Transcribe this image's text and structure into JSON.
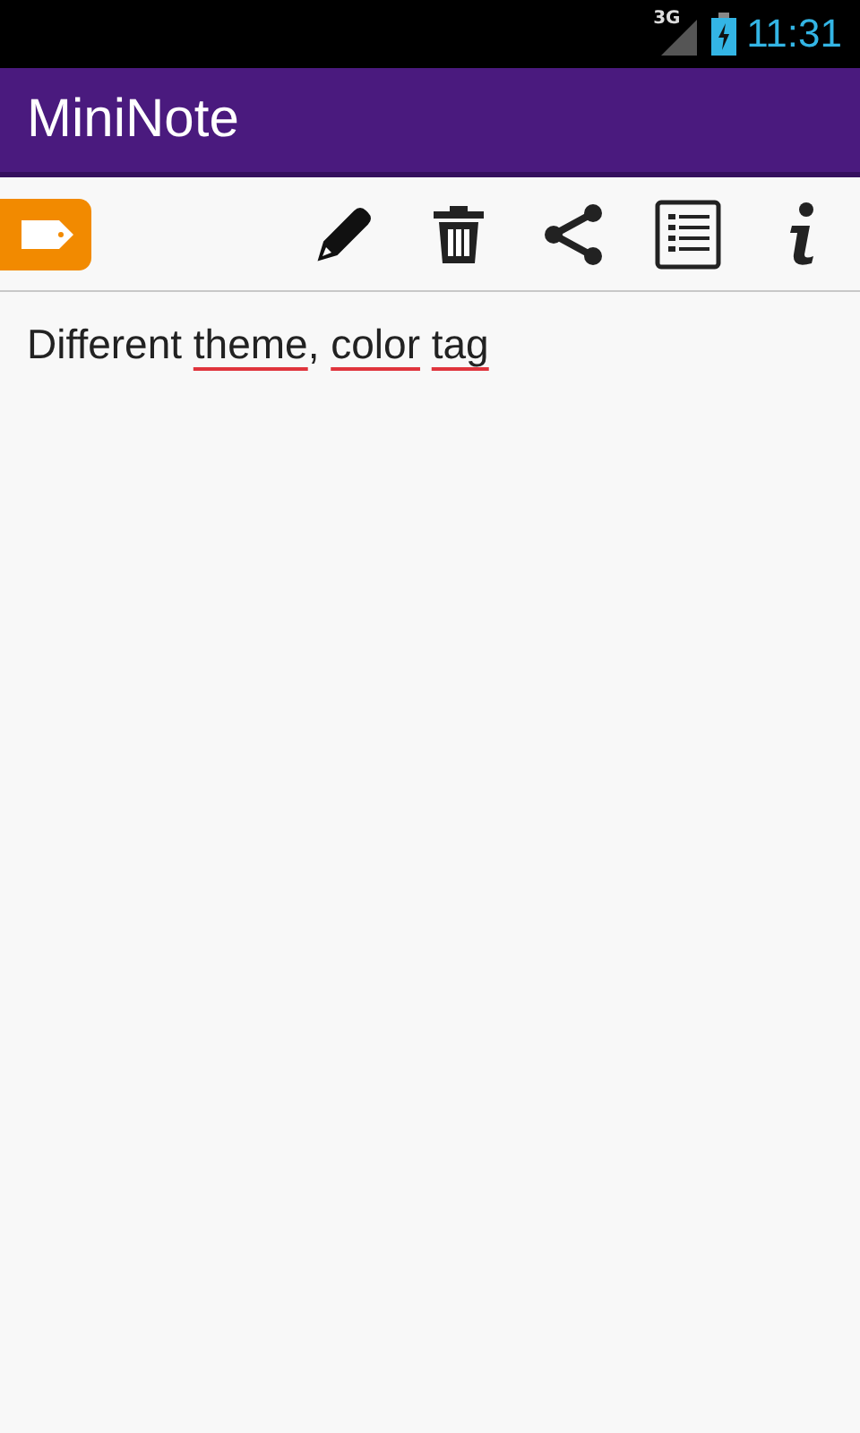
{
  "status_bar": {
    "network": "3G",
    "time": "11:31"
  },
  "app_bar": {
    "title": "MiniNote"
  },
  "toolbar": {
    "tag": {
      "color": "#f28a00"
    },
    "actions": [
      {
        "kind": "edit"
      },
      {
        "kind": "delete"
      },
      {
        "kind": "share"
      },
      {
        "kind": "list"
      },
      {
        "kind": "info"
      }
    ]
  },
  "note": {
    "words": [
      {
        "text": "Different",
        "flagged": false
      },
      {
        "text": "theme",
        "flagged": true,
        "punctuation": ","
      },
      {
        "text": "color",
        "flagged": true
      },
      {
        "text": "tag",
        "flagged": true
      }
    ]
  }
}
